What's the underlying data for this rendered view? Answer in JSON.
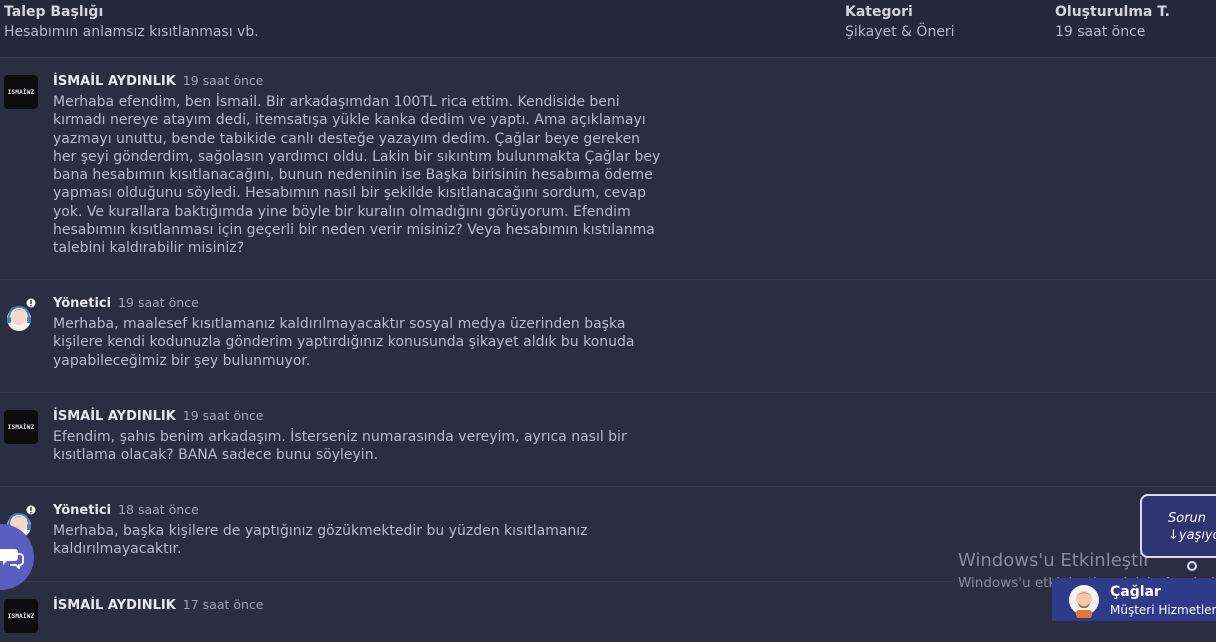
{
  "header": {
    "subject_title": "Talep Başlığı",
    "subject_value": "Hesabımın anlamsız kısıtlanması vb.",
    "category_title": "Kategori",
    "category_value": "Şikayet & Öneri",
    "created_title": "Oluşturulma T.",
    "created_value": "19 saat önce"
  },
  "messages": [
    {
      "author": "İSMAİL AYDINLIK",
      "time": "19 saat önce",
      "avatar_text": "ISMAİWZ",
      "text": "Merhaba efendim, ben İsmail. Bir arkadaşımdan 100TL rica ettim. Kendiside beni kırmadı nereye atayım dedi, itemsatışa yükle kanka dedim ve yaptı. Ama açıklamayı yazmayı unuttu, bende tabikide canlı desteğe yazayım dedim. Çağlar beye gereken her şeyi gönderdim, sağolasın yardımcı oldu. Lakin bir sıkıntım bulunmakta Çağlar bey bana hesabımın kısıtlanacağını, bunun nedeninin ise Başka birisinin hesabıma ödeme yapması olduğunu söyledi. Hesabımın nasıl bir şekilde kısıtlanacağını sordum, cevap yok. Ve kurallara baktığımda yine böyle bir kuralın olmadığını görüyorum. Efendim hesabımın kısıtlanması için geçerli bir neden verir misiniz? Veya hesabımın kıstılanma talebini kaldırabilir misiniz?"
    },
    {
      "author": "Yönetici",
      "time": "19 saat önce",
      "text": "Merhaba, maalesef kısıtlamanız kaldırılmayacaktır sosyal medya üzerinden başka kişilere kendi kodunuzla gönderim yaptırdığınız konusunda şikayet aldık bu konuda yapabileceğimiz bir şey bulunmuyor."
    },
    {
      "author": "İSMAİL AYDINLIK",
      "time": "19 saat önce",
      "avatar_text": "ISMAİWZ",
      "text": "Efendim, şahıs benim arkadaşım. İsterseniz numarasında vereyim, ayrıca nasıl bir kısıtlama olacak? BANA sadece bunu söyleyin."
    },
    {
      "author": "Yönetici",
      "time": "18 saat önce",
      "text": "Merhaba, başka kişilere de yaptığınız gözükmektedir bu yüzden kısıtlamanız kaldırılmayacaktır."
    },
    {
      "author": "İSMAİL AYDINLIK",
      "time": "17 saat önce",
      "avatar_text": "ISMAİWZ",
      "text": ""
    }
  ],
  "watermark": {
    "title": "Windows'u Etkinleştir",
    "subtitle": "Windows'u etkinleştirmek için Ayarlar'a"
  },
  "support_widget": {
    "bubble_text": "Sorun\n↓yaşıyo",
    "agent_name": "Çağlar",
    "agent_role": "Müşteri Hizmetleri"
  },
  "colors": {
    "background": "#2b2d41",
    "header_bg": "#25273a",
    "accent": "#5a5ec1",
    "agent_bar": "#2f3a8a"
  },
  "icons": {
    "chat_fab": "chat-bubbles-icon",
    "admin_avatar": "headset-agent-icon"
  }
}
